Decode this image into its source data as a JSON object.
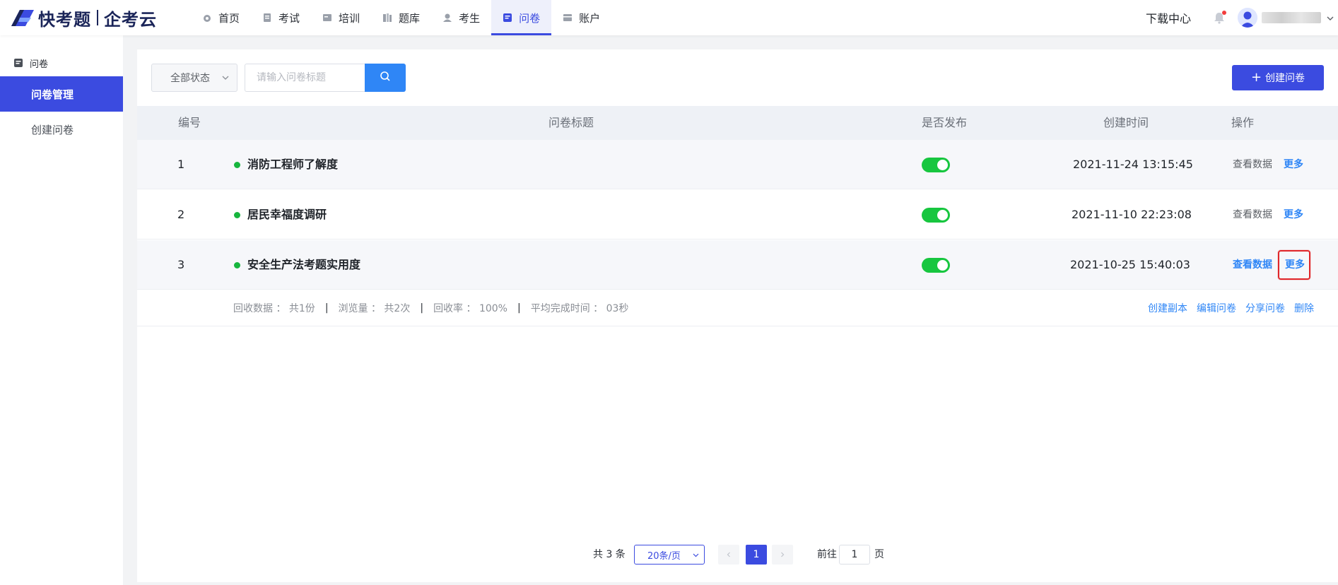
{
  "logo": {
    "brand": "快考题",
    "product": "企考云"
  },
  "nav": [
    {
      "label": "首页",
      "icon": "home-icon",
      "active": false
    },
    {
      "label": "考试",
      "icon": "exam-icon",
      "active": false
    },
    {
      "label": "培训",
      "icon": "training-icon",
      "active": false
    },
    {
      "label": "题库",
      "icon": "question-bank-icon",
      "active": false
    },
    {
      "label": "考生",
      "icon": "examinee-icon",
      "active": false
    },
    {
      "label": "问卷",
      "icon": "survey-icon",
      "active": true
    },
    {
      "label": "账户",
      "icon": "account-icon",
      "active": false
    }
  ],
  "header": {
    "download_center": "下载中心"
  },
  "sidebar": {
    "group_label": "问卷",
    "items": [
      {
        "label": "问卷管理",
        "active": true
      },
      {
        "label": "创建问卷",
        "active": false
      }
    ]
  },
  "toolbar": {
    "status_filter": "全部状态",
    "search_placeholder": "请输入问卷标题",
    "create_button": "创建问卷"
  },
  "table": {
    "headers": {
      "id": "编号",
      "title": "问卷标题",
      "published": "是否发布",
      "created": "创建时间",
      "actions": "操作"
    },
    "rows": [
      {
        "id": "1",
        "title": "消防工程师了解度",
        "published": true,
        "created": "2021-11-24 13:15:45",
        "view": "查看数据",
        "more": "更多"
      },
      {
        "id": "2",
        "title": "居民幸福度调研",
        "published": true,
        "created": "2021-11-10 22:23:08",
        "view": "查看数据",
        "more": "更多"
      },
      {
        "id": "3",
        "title": "安全生产法考题实用度",
        "published": true,
        "created": "2021-10-25 15:40:03",
        "view": "查看数据",
        "more": "更多"
      }
    ],
    "expanded": {
      "stats": [
        "回收数据 ： 共1份",
        "浏览量 ： 共2次",
        "回收率 ： 100%",
        "平均完成时间 ： 03秒"
      ],
      "separator": "|",
      "actions": [
        "创建副本",
        "编辑问卷",
        "分享问卷",
        "删除"
      ]
    }
  },
  "pagination": {
    "total": "共 3 条",
    "page_size": "20条/页",
    "current_page": "1",
    "goto_prefix": "前往",
    "goto_value": "1",
    "goto_suffix": "页"
  },
  "colors": {
    "primary": "#3b4be0",
    "link": "#2f86f6",
    "switch_on": "#17c63f",
    "status_dot": "#17b53e",
    "highlight": "#e0262a"
  }
}
